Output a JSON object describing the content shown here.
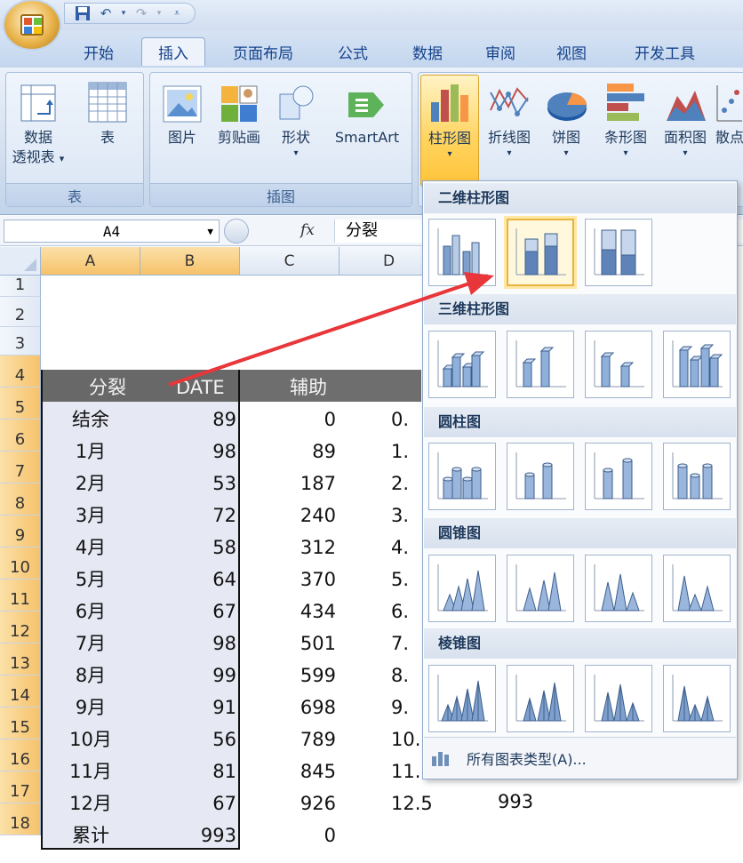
{
  "tabs": [
    "开始",
    "插入",
    "页面布局",
    "公式",
    "数据",
    "审阅",
    "视图",
    "开发工具"
  ],
  "active_tab": "插入",
  "groups": {
    "table": {
      "caption": "表",
      "buttons": [
        {
          "label": "数据",
          "label2": "透视表",
          "arrow": "▾"
        },
        {
          "label": "表"
        }
      ]
    },
    "illustrations": {
      "caption": "插图",
      "buttons": [
        {
          "label": "图片"
        },
        {
          "label": "剪贴画"
        },
        {
          "label": "形状",
          "arrow": "▾"
        },
        {
          "label": "SmartArt"
        }
      ]
    },
    "charts": {
      "buttons": [
        {
          "label": "柱形图",
          "arrow": "▾"
        },
        {
          "label": "折线图",
          "arrow": "▾"
        },
        {
          "label": "饼图",
          "arrow": "▾"
        },
        {
          "label": "条形图",
          "arrow": "▾"
        },
        {
          "label": "面积图",
          "arrow": "▾"
        },
        {
          "label": "散点"
        }
      ]
    }
  },
  "formula_bar": {
    "name_box": "A4",
    "fx": "fx",
    "value": "分裂"
  },
  "columns": [
    "A",
    "B",
    "C",
    "D"
  ],
  "rows": [
    "1",
    "2",
    "3",
    "4",
    "5",
    "6",
    "7",
    "8",
    "9",
    "10",
    "11",
    "12",
    "13",
    "14",
    "15",
    "16",
    "17",
    "18"
  ],
  "table": {
    "headers": [
      "分裂",
      "DATE",
      "辅助"
    ],
    "data": [
      [
        "结余",
        "89",
        "0",
        "0."
      ],
      [
        "1月",
        "98",
        "89",
        "1."
      ],
      [
        "2月",
        "53",
        "187",
        "2."
      ],
      [
        "3月",
        "72",
        "240",
        "3."
      ],
      [
        "4月",
        "58",
        "312",
        "4."
      ],
      [
        "5月",
        "64",
        "370",
        "5."
      ],
      [
        "6月",
        "67",
        "434",
        "6."
      ],
      [
        "7月",
        "98",
        "501",
        "7."
      ],
      [
        "8月",
        "99",
        "599",
        "8."
      ],
      [
        "9月",
        "91",
        "698",
        "9."
      ],
      [
        "10月",
        "56",
        "789",
        "10."
      ],
      [
        "11月",
        "81",
        "845",
        "11."
      ],
      [
        "12月",
        "67",
        "926",
        "12.5"
      ],
      [
        "累计",
        "993",
        "0",
        ""
      ]
    ],
    "extra_e17": "993"
  },
  "dropdown": {
    "sections": [
      "二维柱形图",
      "三维柱形图",
      "圆柱图",
      "圆锥图",
      "棱锥图"
    ],
    "all_charts": "所有图表类型(A)..."
  },
  "colors": {
    "accent_arrow": "#e8363a",
    "hover": "#ffd35c"
  }
}
